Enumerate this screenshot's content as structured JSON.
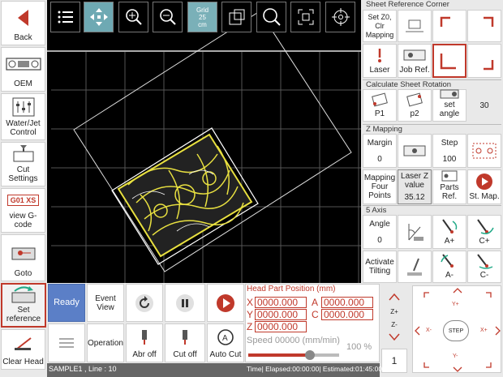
{
  "left": {
    "back": "Back",
    "oem": "OEM",
    "waterjet": "Water/Jet Control",
    "cut_settings": "Cut Settings",
    "view_gcode": "view G-code",
    "gcode_badge": "G01 XS",
    "goto": "Goto",
    "set_reference": "Set reference",
    "clear_head": "Clear Head"
  },
  "toolbar": {
    "grid_line1": "Grid",
    "grid_line2": "25",
    "grid_line3": "cm"
  },
  "right": {
    "sheet_ref_title": "Sheet Reference Corner",
    "set_z0": "Set Z0, Clr Mapping",
    "laser": "Laser",
    "job_ref": "Job Ref.",
    "calc_rotation_title": "Calculate Sheet Rotation",
    "p1": "P1",
    "p2": "p2",
    "set_angle": "set angle",
    "angle_value": "30",
    "z_mapping_title": "Z Mapping",
    "margin_label": "Margin",
    "margin_value": "0",
    "step_label": "Step",
    "step_value": "100",
    "mapping_four_points": "Mapping Four Points",
    "laser_z_label": "Laser Z value",
    "laser_z_value": "35.12",
    "parts_ref": "Parts Ref.",
    "st_map": "St. Map.",
    "five_axis_title": "5 Axis",
    "angle_label": "Angle",
    "angle_val": "0",
    "a_plus": "A+",
    "c_plus": "C+",
    "activate_tilting": "Activate Tilting",
    "a_minus": "A-",
    "c_minus": "C-"
  },
  "bottom": {
    "ready": "Ready",
    "event_view": "Event View",
    "operation": "Operation",
    "abr_off": "Abr off",
    "cut_off": "Cut off",
    "auto_cut": "Auto Cut",
    "head_title": "Head Part Position (mm)",
    "x_label": "X",
    "x_value": "0000.000",
    "y_label": "Y",
    "y_value": "0000.000",
    "z_label": "Z",
    "z_value": "0000.000",
    "a_label": "A",
    "a_value": "0000.000",
    "c_label": "C",
    "c_value": "0000.000",
    "speed_text": "Speed 00000  (mm/min)",
    "speed_percent": "100 %",
    "speed_fraction": 0.68,
    "z_up": "Z+",
    "z_down": "Z-",
    "step_count": "1",
    "jog_step": "STEP",
    "jog_y_plus": "Y+",
    "jog_y_minus": "Y-",
    "jog_x_plus": "X+",
    "jog_x_minus": "X-"
  },
  "status": {
    "file": "SAMPLE1 , Line : 10",
    "time": "Time| Elapsed:00:00:00| Estimated:01:45:00"
  },
  "colors": {
    "accent_red": "#c0392b",
    "ready_blue": "#5b7fc7",
    "canvas_bg": "#000000",
    "part_yellow": "#e8e040"
  }
}
